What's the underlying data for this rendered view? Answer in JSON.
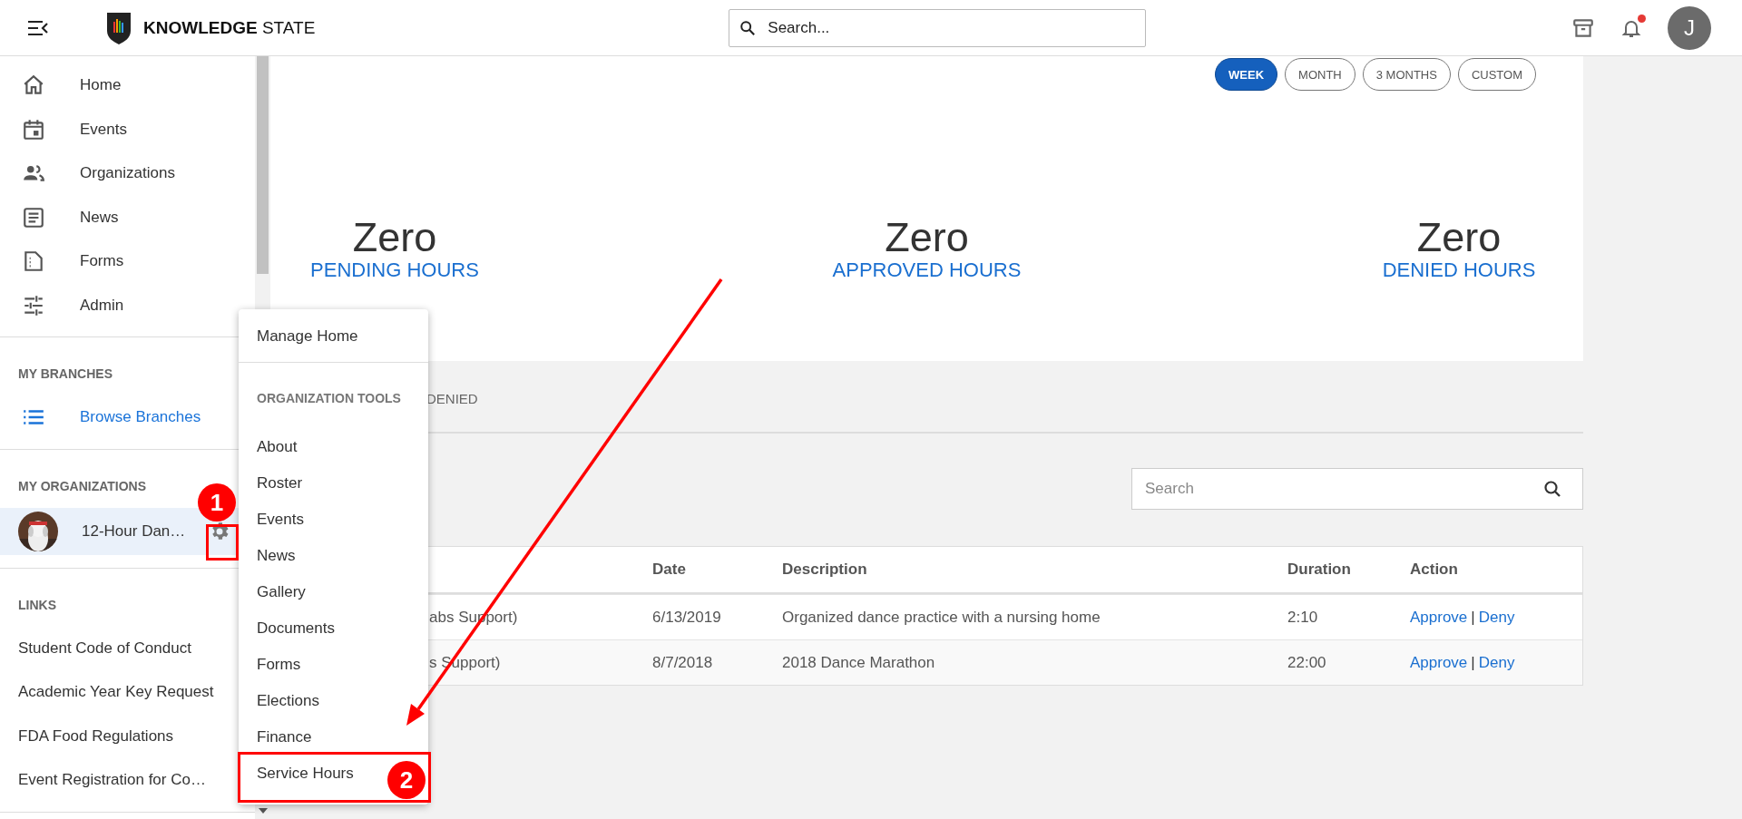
{
  "header": {
    "brand_bold": "KNOWLEDGE",
    "brand_light": "STATE",
    "search_placeholder": "Search...",
    "avatar_initial": "J",
    "notification_dot": true
  },
  "sidebar": {
    "nav": [
      "Home",
      "Events",
      "Organizations",
      "News",
      "Forms",
      "Admin"
    ],
    "branches": {
      "heading": "MY BRANCHES",
      "items": [
        "Browse Branches"
      ]
    },
    "organizations": {
      "heading": "MY ORGANIZATIONS",
      "items": [
        {
          "label": "12-Hour Dan…",
          "selected": true
        }
      ]
    },
    "links": {
      "heading": "LINKS",
      "items": [
        "Student Code of Conduct",
        "Academic Year Key Request",
        "FDA Food Regulations",
        "Event Registration for Co…"
      ]
    }
  },
  "period_buttons": [
    {
      "label": "WEEK",
      "selected": true
    },
    {
      "label": "MONTH",
      "selected": false
    },
    {
      "label": "3 MONTHS",
      "selected": false
    },
    {
      "label": "CUSTOM",
      "selected": false
    }
  ],
  "stats": [
    {
      "value": "Zero",
      "label": "PENDING HOURS"
    },
    {
      "value": "Zero",
      "label": "APPROVED HOURS"
    },
    {
      "value": "Zero",
      "label": "DENIED HOURS"
    }
  ],
  "tabs": [
    "DENIED"
  ],
  "search": {
    "placeholder": "Search"
  },
  "table": {
    "columns": [
      "Date",
      "Description",
      "Duration",
      "Action"
    ],
    "action_separator": "|",
    "rows": [
      {
        "column_1": "abs Support)",
        "date": "6/13/2019",
        "description": "Organized dance practice with a nursing home",
        "duration": "2:10",
        "actions": [
          "Approve",
          "Deny"
        ]
      },
      {
        "column_1": "s Support)",
        "date": "8/7/2018",
        "description": "2018 Dance Marathon",
        "duration": "22:00",
        "actions": [
          "Approve",
          "Deny"
        ]
      }
    ]
  },
  "menu": {
    "top_items": [
      "Manage Home"
    ],
    "section_heading": "ORGANIZATION TOOLS",
    "items": [
      "About",
      "Roster",
      "Events",
      "News",
      "Gallery",
      "Documents",
      "Forms",
      "Elections",
      "Finance",
      "Service Hours"
    ]
  },
  "annotations": [
    "1",
    "2"
  ]
}
